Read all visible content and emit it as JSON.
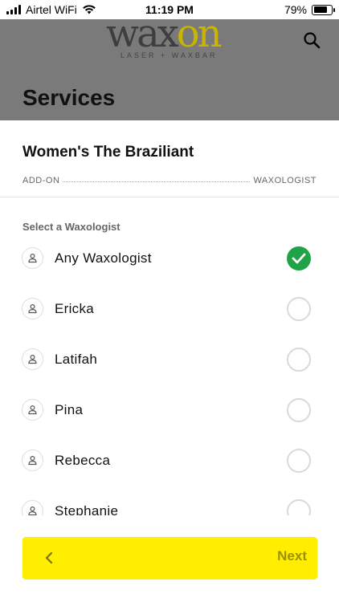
{
  "status_bar": {
    "carrier": "Airtel WiFi",
    "time": "11:19 PM",
    "battery": "79%",
    "battery_level": 0.79
  },
  "header": {
    "logo_text_1": "wax",
    "logo_text_2": "on",
    "logo_subtitle": "LASER + WAXBAR",
    "title": "Services",
    "search_icon": "search-icon"
  },
  "service": {
    "name": "Women's The Braziliant",
    "steps": [
      "ADD-ON",
      "WAXOLOGIST"
    ]
  },
  "waxologists": {
    "label": "Select a Waxologist",
    "items": [
      {
        "name": "Any Waxologist",
        "selected": true
      },
      {
        "name": "Ericka",
        "selected": false
      },
      {
        "name": "Latifah",
        "selected": false
      },
      {
        "name": "Pina",
        "selected": false
      },
      {
        "name": "Rebecca",
        "selected": false
      },
      {
        "name": "Stephanie",
        "selected": false
      }
    ]
  },
  "footer": {
    "next_label": "Next",
    "back_icon": "chevron-left-icon"
  },
  "colors": {
    "accent": "#ffee00",
    "header_bg": "#7a7a7a",
    "check": "#1fa346"
  }
}
